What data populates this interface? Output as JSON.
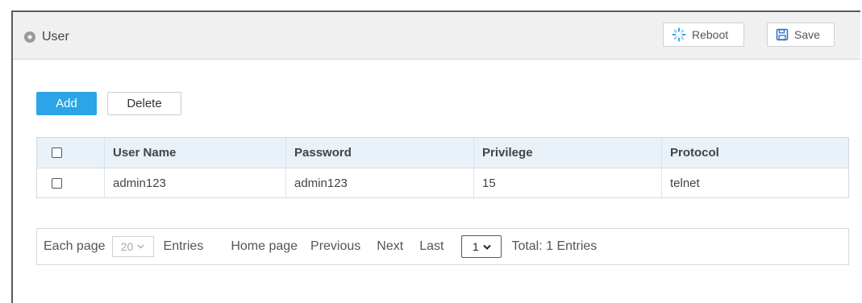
{
  "header": {
    "title": "User",
    "reboot_label": "Reboot",
    "save_label": "Save"
  },
  "toolbar": {
    "add_label": "Add",
    "delete_label": "Delete"
  },
  "table": {
    "columns": [
      "User Name",
      "Password",
      "Privilege",
      "Protocol"
    ],
    "rows": [
      {
        "user_name": "admin123",
        "password": "admin123",
        "privilege": "15",
        "protocol": "telnet"
      }
    ]
  },
  "pager": {
    "each_page_label": "Each page",
    "page_size": "20",
    "entries_label": "Entries",
    "home_label": "Home page",
    "previous_label": "Previous",
    "next_label": "Next",
    "last_label": "Last",
    "current_page": "1",
    "total_label": "Total: 1 Entries"
  },
  "colors": {
    "accent": "#2ba5e8",
    "header_bg": "#f0f0f0",
    "table_head_bg": "#e9f1f9",
    "reboot_icon": "#2ba5e8",
    "save_icon": "#2b6fc4"
  },
  "icons": {
    "title": "circle-dot-icon",
    "reboot": "spinner-icon",
    "save": "floppy-disk-icon",
    "dropdown": "chevron-down-icon"
  }
}
